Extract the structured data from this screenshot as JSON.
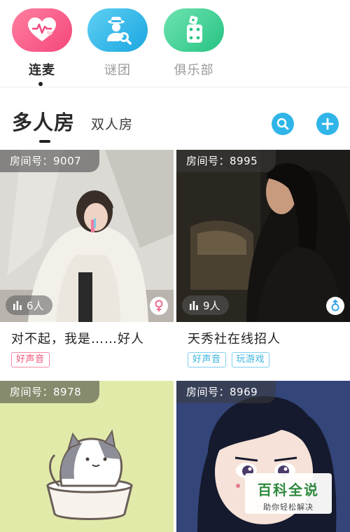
{
  "top_tabs": [
    {
      "label": "连麦",
      "icon": "heart-pulse-icon",
      "color": "#f55c87",
      "active": true
    },
    {
      "label": "谜团",
      "icon": "detective-icon",
      "color": "#2fb5e8",
      "active": false
    },
    {
      "label": "俱乐部",
      "icon": "dice-icon",
      "color": "#3fcf8f",
      "active": false
    }
  ],
  "room_types": {
    "primary": "多人房",
    "secondary": "双人房"
  },
  "actions": {
    "search_icon": "search-icon",
    "add_icon": "plus-icon",
    "accent": "#2fb5e8"
  },
  "rooms": [
    {
      "room_id": "房间号：9007",
      "count": "6人",
      "gender": "female",
      "title": "对不起，我是……好人",
      "tags": [
        "好声音"
      ]
    },
    {
      "room_id": "房间号：8995",
      "count": "9人",
      "gender": "male",
      "title": "天秀社在线招人",
      "tags": [
        "好声音",
        "玩游戏"
      ]
    },
    {
      "room_id": "房间号：8978"
    },
    {
      "room_id": "房间号：8969"
    }
  ],
  "watermark": {
    "title": "百科全说",
    "subtitle": "助你轻松解决"
  }
}
